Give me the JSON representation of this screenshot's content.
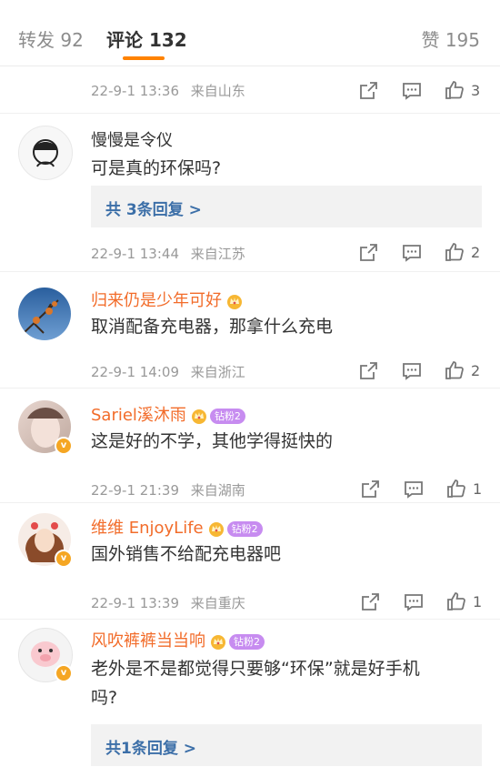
{
  "tabs": {
    "repost": "转发 92",
    "comments": "评论 132",
    "likes": "赞 195"
  },
  "comments": [
    {
      "text": "",
      "date": "22-9-1 13:36",
      "location": "来自山东",
      "likes": "3"
    },
    {
      "username": "慢慢是令仪",
      "text": "可是真的环保吗?",
      "replies": "共 3条回复 >",
      "date": "22-9-1 13:44",
      "location": "来自江苏",
      "likes": "2"
    },
    {
      "username": "归来仍是少年可好",
      "text": "取消配备充电器，那拿什么充电",
      "date": "22-9-1 14:09",
      "location": "来自浙江",
      "likes": "2"
    },
    {
      "username": "Sariel溪沐雨",
      "fan_badge": "钻粉2",
      "text": "这是好的不学，其他学得挺快的",
      "date": "22-9-1 21:39",
      "location": "来自湖南",
      "likes": "1"
    },
    {
      "username": "维维 EnjoyLife",
      "fan_badge": "钻粉2",
      "text": "国外销售不给配充电器吧",
      "date": "22-9-1 13:39",
      "location": "来自重庆",
      "likes": "1"
    },
    {
      "username": "风吹裤裤当当响",
      "fan_badge": "钻粉2",
      "text_line1": "老外是不是都觉得只要够“环保”就是好手机",
      "text_line2": "吗?",
      "replies": "共1条回复 >"
    }
  ],
  "icons": {
    "repost": "share-icon",
    "comment": "comment-icon",
    "like": "thumbs-up-icon"
  },
  "colors": {
    "accent": "#ff8200",
    "vip_name": "#f26c2a",
    "reply_link": "#3c6fa8"
  }
}
